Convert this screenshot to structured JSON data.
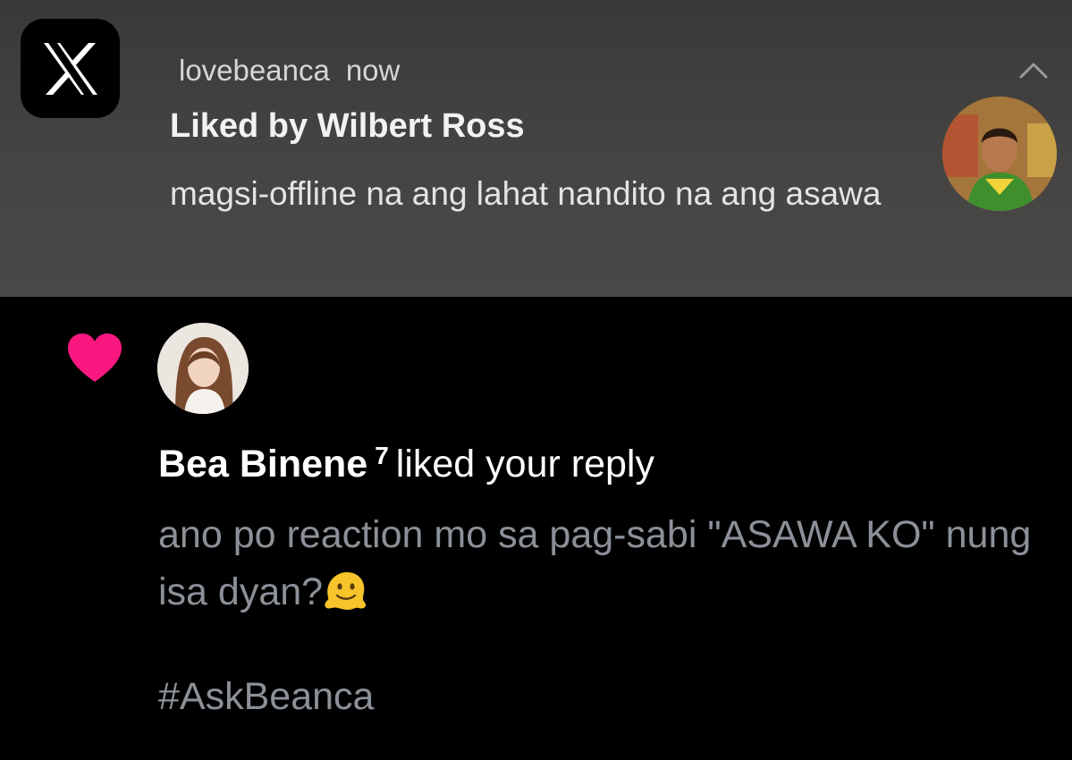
{
  "notification": {
    "app_icon": "x-logo-icon",
    "account": "lovebeanca",
    "time": "now",
    "title": "Liked by Wilbert Ross",
    "body": "magsi-offline na ang lahat nandito na ang asawa",
    "collapse_icon": "chevron-up-icon",
    "avatar": "user-avatar"
  },
  "like_item": {
    "icon": "heart-icon",
    "icon_color": "#f91880",
    "avatar": "user-avatar",
    "name": "Bea Binene",
    "badge": "7",
    "action": "liked your reply",
    "reply_text": "ano po reaction mo sa pag-sabi \"ASAWA KO\" nung isa dyan?",
    "emoji": "melting-face-emoji",
    "hashtag": "#AskBeanca"
  },
  "colors": {
    "background": "#000000",
    "banner": "#454443",
    "muted_text": "#8b9197"
  }
}
